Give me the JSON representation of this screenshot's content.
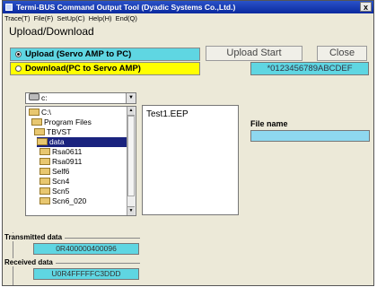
{
  "window": {
    "title": "Termi-BUS Command Output Tool (Dyadic Systems Co.,Ltd.)",
    "close_label": "x"
  },
  "menu": {
    "items": [
      "Trace(T)",
      "File(F)",
      "SetUp(C)",
      "Help(H)",
      "End(Q)"
    ]
  },
  "upload_download": {
    "group_title": "Upload/Download",
    "upload_option": "Upload  (Servo AMP to PC)",
    "download_option": "Download(PC to Servo AMP)",
    "upload_start_label": "Upload  Start",
    "close_label": "Close",
    "serial_value": "*0123456789ABCDEF",
    "upload_color": "#5fd6e2",
    "download_color": "#ffff00"
  },
  "drive": {
    "value": "c:"
  },
  "tree": {
    "items": [
      {
        "label": "C:\\"
      },
      {
        "label": "Program Files"
      },
      {
        "label": "TBVST"
      },
      {
        "label": "data"
      },
      {
        "label": "Rsa0611"
      },
      {
        "label": "Rsa0911"
      },
      {
        "label": "Self6"
      },
      {
        "label": "Scn4"
      },
      {
        "label": "Scn5"
      },
      {
        "label": "Scn6_020"
      }
    ]
  },
  "files": {
    "items": [
      "Test1.EEP"
    ]
  },
  "file_name": {
    "label": "File name",
    "value": ""
  },
  "transmitted": {
    "label": "Transmitted data",
    "value": "0R400000400096"
  },
  "received": {
    "label": "Received data",
    "value": "U0R4FFFFFC3DDD"
  }
}
